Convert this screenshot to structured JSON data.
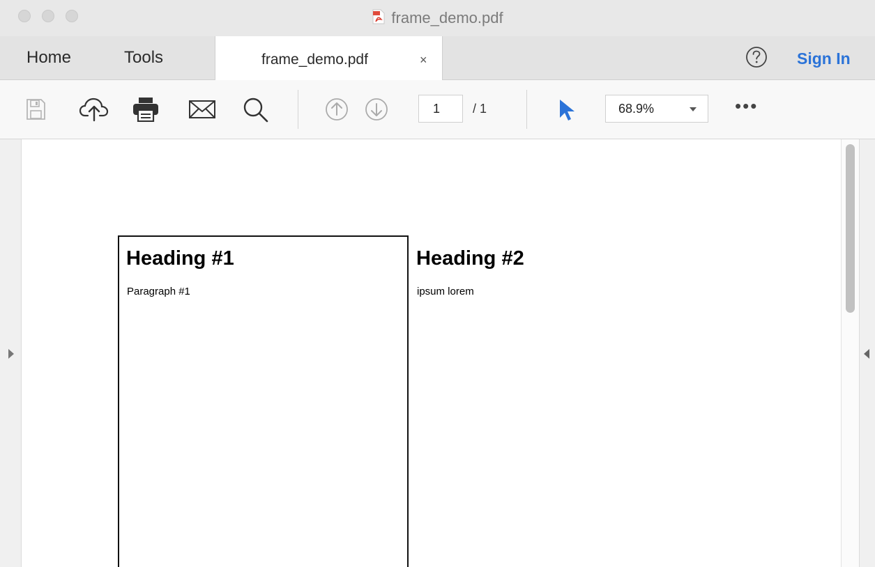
{
  "window": {
    "title": "frame_demo.pdf"
  },
  "tabs": {
    "home_label": "Home",
    "tools_label": "Tools",
    "document_label": "frame_demo.pdf",
    "close_glyph": "×"
  },
  "header": {
    "help_icon": "help-circle-icon",
    "sign_in_label": "Sign In",
    "accent_color": "#2b73d8"
  },
  "toolbar": {
    "icons": [
      "save-icon",
      "cloud-upload-icon",
      "print-icon",
      "email-icon",
      "search-icon",
      "previous-page-icon",
      "next-page-icon",
      "select-cursor-icon",
      "more-icon"
    ],
    "current_page": "1",
    "total_pages": "/ 1",
    "zoom_value": "68.9%",
    "more_label": "•••"
  },
  "document": {
    "heading_1": "Heading #1",
    "paragraph_1": "Paragraph #1",
    "heading_2": "Heading #2",
    "paragraph_2": "ipsum lorem"
  }
}
